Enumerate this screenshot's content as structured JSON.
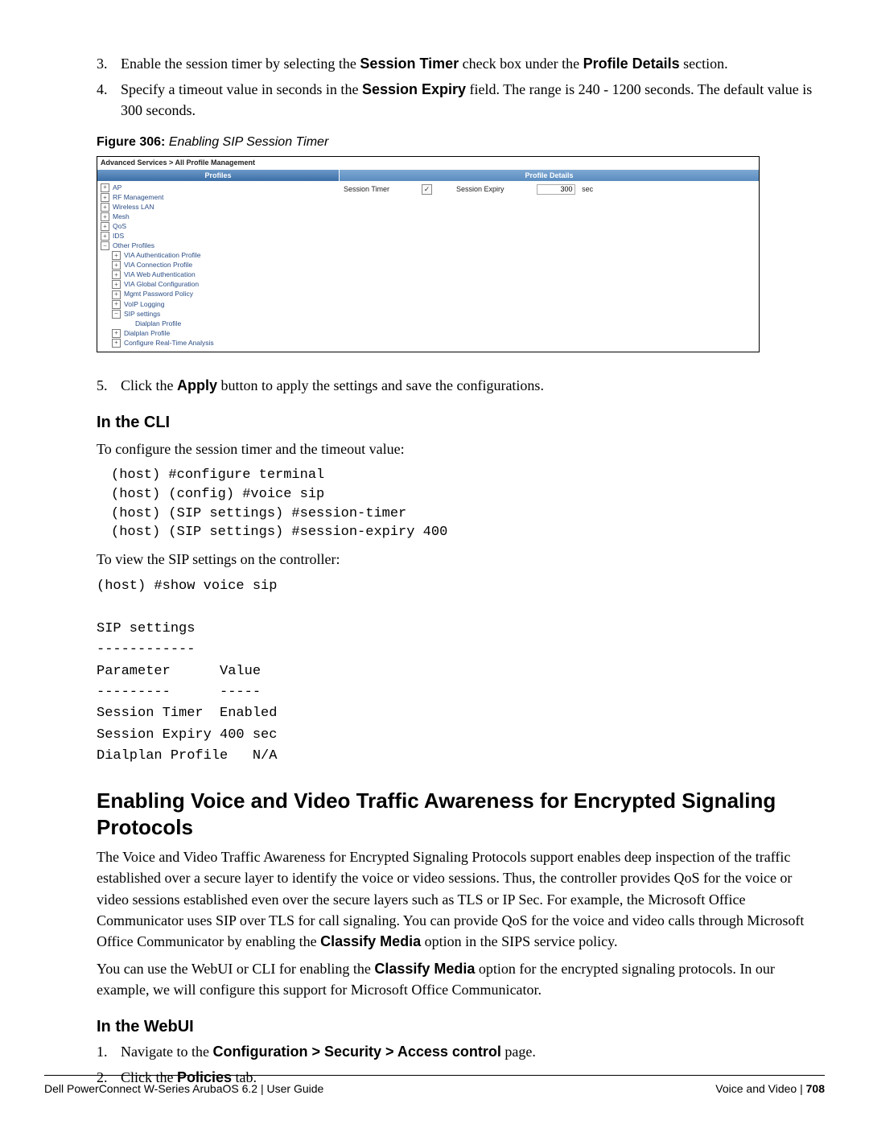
{
  "steps_top": [
    {
      "num": "3.",
      "html": "Enable the session timer by selecting the <span class='sans bold'>Session Timer</span> check box under the <span class='sans bold'>Profile Details</span> section."
    },
    {
      "num": "4.",
      "html": "Specify a timeout value in seconds in the <span class='sans bold'>Session Expiry</span> field. The range is 240 - 1200 seconds. The default value is 300 seconds."
    }
  ],
  "figure": {
    "label_strong": "Figure 306:",
    "label_em": "Enabling SIP Session Timer",
    "crumb": "Advanced Services > All Profile Management",
    "tab_left": "Profiles",
    "tab_right": "Profile Details",
    "tree": [
      {
        "lvl": 1,
        "pm": "+",
        "txt": "AP"
      },
      {
        "lvl": 1,
        "pm": "+",
        "txt": "RF Management"
      },
      {
        "lvl": 1,
        "pm": "+",
        "txt": "Wireless LAN"
      },
      {
        "lvl": 1,
        "pm": "+",
        "txt": "Mesh"
      },
      {
        "lvl": 1,
        "pm": "+",
        "txt": "QoS"
      },
      {
        "lvl": 1,
        "pm": "+",
        "txt": "IDS"
      },
      {
        "lvl": 1,
        "pm": "−",
        "txt": "Other Profiles"
      },
      {
        "lvl": 2,
        "pm": "+",
        "txt": "VIA Authentication Profile"
      },
      {
        "lvl": 2,
        "pm": "+",
        "txt": "VIA Connection Profile"
      },
      {
        "lvl": 2,
        "pm": "+",
        "txt": "VIA Web Authentication"
      },
      {
        "lvl": 2,
        "pm": "+",
        "txt": "VIA Global Configuration"
      },
      {
        "lvl": 2,
        "pm": "+",
        "txt": "Mgmt Password Policy"
      },
      {
        "lvl": 2,
        "pm": "+",
        "txt": "VoIP Logging"
      },
      {
        "lvl": 2,
        "pm": "−",
        "txt": "SIP settings"
      },
      {
        "lvl": 3,
        "pm": "",
        "txt": "Dialplan Profile"
      },
      {
        "lvl": 2,
        "pm": "+",
        "txt": "Dialplan Profile"
      },
      {
        "lvl": 2,
        "pm": "+",
        "txt": "Configure Real-Time Analysis"
      }
    ],
    "detail": {
      "session_timer_label": "Session Timer",
      "session_timer_checked": "✓",
      "session_expiry_label": "Session Expiry",
      "session_expiry_value": "300",
      "session_expiry_unit": "sec"
    }
  },
  "step5": {
    "num": "5.",
    "html": "Click the <span class='sans bold'>Apply</span> button to apply the settings and save the configurations."
  },
  "cli_heading": "In the CLI",
  "cli_intro": "To configure the session timer and the timeout value:",
  "cli_block1": "(host) #configure terminal\n(host) (config) #voice sip\n(host) (SIP settings) #session-timer\n(host) (SIP settings) #session-expiry 400",
  "cli_intro2": "To view the SIP settings on the controller:",
  "cli_block2": "(host) #show voice sip\n\nSIP settings\n------------\nParameter      Value\n---------      -----\nSession Timer  Enabled\nSession Expiry 400 sec\nDialplan Profile   N/A",
  "big_heading": "Enabling Voice and Video Traffic Awareness for Encrypted Signaling Protocols",
  "para1": "The Voice and Video Traffic Awareness for Encrypted Signaling Protocols support enables deep inspection of the traffic established over a secure layer to identify the voice or video sessions. Thus, the controller provides QoS for the voice or video sessions established even over the secure layers such as TLS or IP Sec. For example, the Microsoft Office Communicator uses SIP over TLS for call signaling. You can provide QoS for the voice and video calls through Microsoft Office Communicator by enabling the <span class='sans bold'>Classify Media</span> option in the SIPS service policy.",
  "para2": "You can use the WebUI or CLI for enabling the <span class='sans bold'>Classify Media</span> option for the encrypted signaling protocols. In our example, we will configure this support for Microsoft Office Communicator.",
  "webui_heading": "In the WebUI",
  "steps_bottom": [
    {
      "num": "1.",
      "html": "Navigate to the <span class='sans bold'>Configuration &gt; Security &gt; Access control</span> page."
    },
    {
      "num": "2.",
      "html": "Click the <span class='sans bold'>Policies</span> tab."
    }
  ],
  "footer": {
    "left": "Dell PowerConnect W-Series ArubaOS 6.2   |   User Guide",
    "right_label": "Voice and Video",
    "sep": "  |  ",
    "page": "708"
  }
}
